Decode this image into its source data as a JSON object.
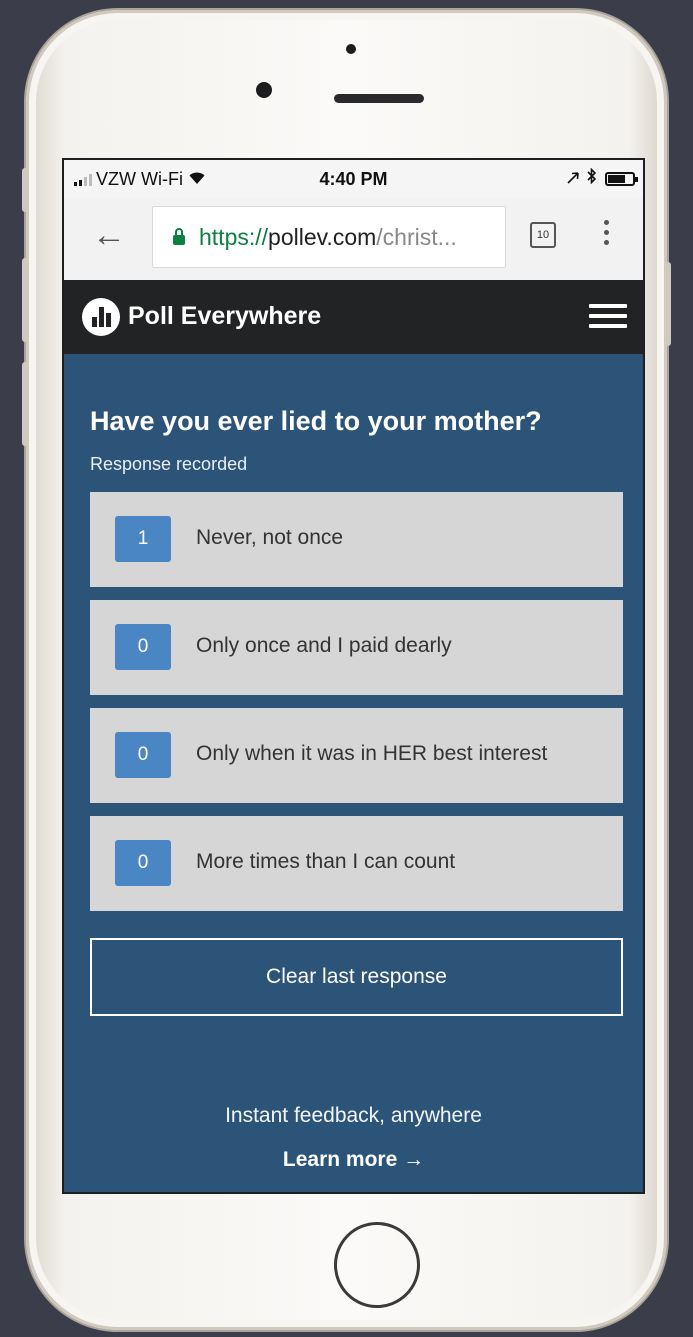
{
  "status_bar": {
    "carrier": "VZW Wi-Fi",
    "time": "4:40 PM"
  },
  "browser": {
    "url_scheme": "https://",
    "url_host": "pollev.com",
    "url_path": "/christ...",
    "tab_count": "10"
  },
  "header": {
    "brand": "Poll Everywhere"
  },
  "poll": {
    "question": "Have you ever lied to your mother?",
    "status": "Response recorded",
    "options": [
      {
        "count": "1",
        "label": "Never, not once"
      },
      {
        "count": "0",
        "label": "Only once and I paid dearly"
      },
      {
        "count": "0",
        "label": "Only when it was in HER best interest"
      },
      {
        "count": "0",
        "label": "More times than I can count"
      }
    ],
    "clear_label": "Clear last response"
  },
  "footer": {
    "tagline": "Instant feedback, anywhere",
    "learn_more": "Learn more →"
  },
  "colors": {
    "poll_background": "#2b5478",
    "header_background": "#222324",
    "count_badge": "#4a86c4",
    "option_background": "#d6d6d6",
    "secure_green": "#0a8043"
  },
  "icons": [
    "wifi-icon",
    "location-arrow-icon",
    "bluetooth-icon",
    "battery-icon",
    "back-arrow-icon",
    "lock-icon",
    "tabs-icon",
    "more-options-icon",
    "poll-everywhere-logo-icon",
    "hamburger-menu-icon"
  ]
}
